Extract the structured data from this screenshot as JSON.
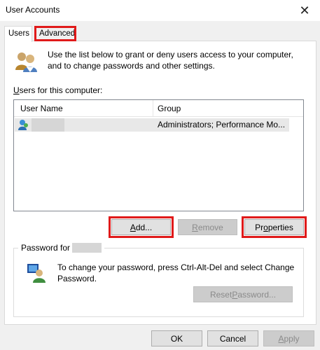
{
  "window": {
    "title": "User Accounts",
    "close_glyph": "✕"
  },
  "tabs": [
    {
      "label": "Users",
      "selected": true
    },
    {
      "label": "Advanced",
      "selected": false,
      "highlighted": true
    }
  ],
  "intro": {
    "line1": "Use the list below to grant or deny users access to your computer,",
    "line2": "and to change passwords and other settings."
  },
  "users_label": {
    "accel": "U",
    "rest": "sers for this computer:"
  },
  "listview": {
    "columns": [
      "User Name",
      "Group"
    ],
    "rows": [
      {
        "user": "",
        "group": "Administrators; Performance Mo..."
      }
    ]
  },
  "buttons": {
    "add": {
      "accel": "A",
      "rest": "dd..."
    },
    "remove": {
      "accel": "R",
      "rest": "emove"
    },
    "properties": {
      "pre": "Pr",
      "accel": "o",
      "rest": "perties"
    },
    "reset": {
      "pre": "Reset ",
      "accel": "P",
      "rest": "assword..."
    },
    "ok": "OK",
    "cancel": "Cancel",
    "apply": {
      "accel": "A",
      "rest": "pply"
    }
  },
  "password_group": {
    "legend": "Password for",
    "line1": "To change your password, press Ctrl-Alt-Del and select Change",
    "line2": "Password."
  },
  "icons": {
    "intro": "users-group-icon",
    "row": "user-icon",
    "password": "password-user-icon"
  },
  "colors": {
    "highlight": "#e01a1a",
    "panel": "#ffffff",
    "background": "#f0f0f0",
    "selected_row": "#e8e8e8"
  }
}
